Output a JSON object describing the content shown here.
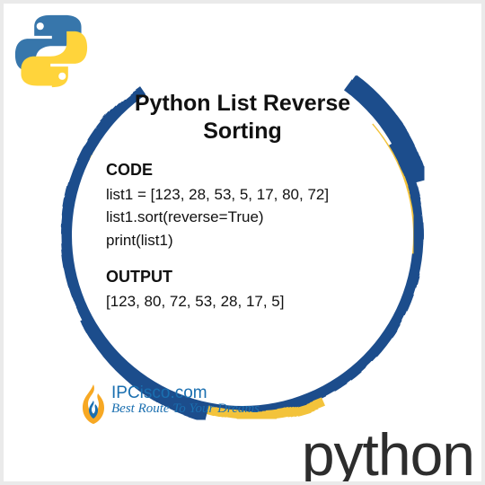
{
  "title": "Python List Reverse Sorting",
  "code_label": "CODE",
  "code": {
    "line1": "list1 = [123, 28, 53, 5, 17, 80, 72]",
    "line2": "list1.sort(reverse=True)",
    "line3": "print(list1)"
  },
  "output_label": "OUTPUT",
  "output": {
    "line1": "[123, 80, 72, 53, 28, 17, 5]"
  },
  "brand": {
    "name": "IPCisco.com",
    "tagline": "Best Route To Your Dreams"
  },
  "wordmark": "python",
  "colors": {
    "brush_blue": "#1f4e8c",
    "brush_yellow": "#f3c33b",
    "brand_blue": "#1a6fb0"
  }
}
